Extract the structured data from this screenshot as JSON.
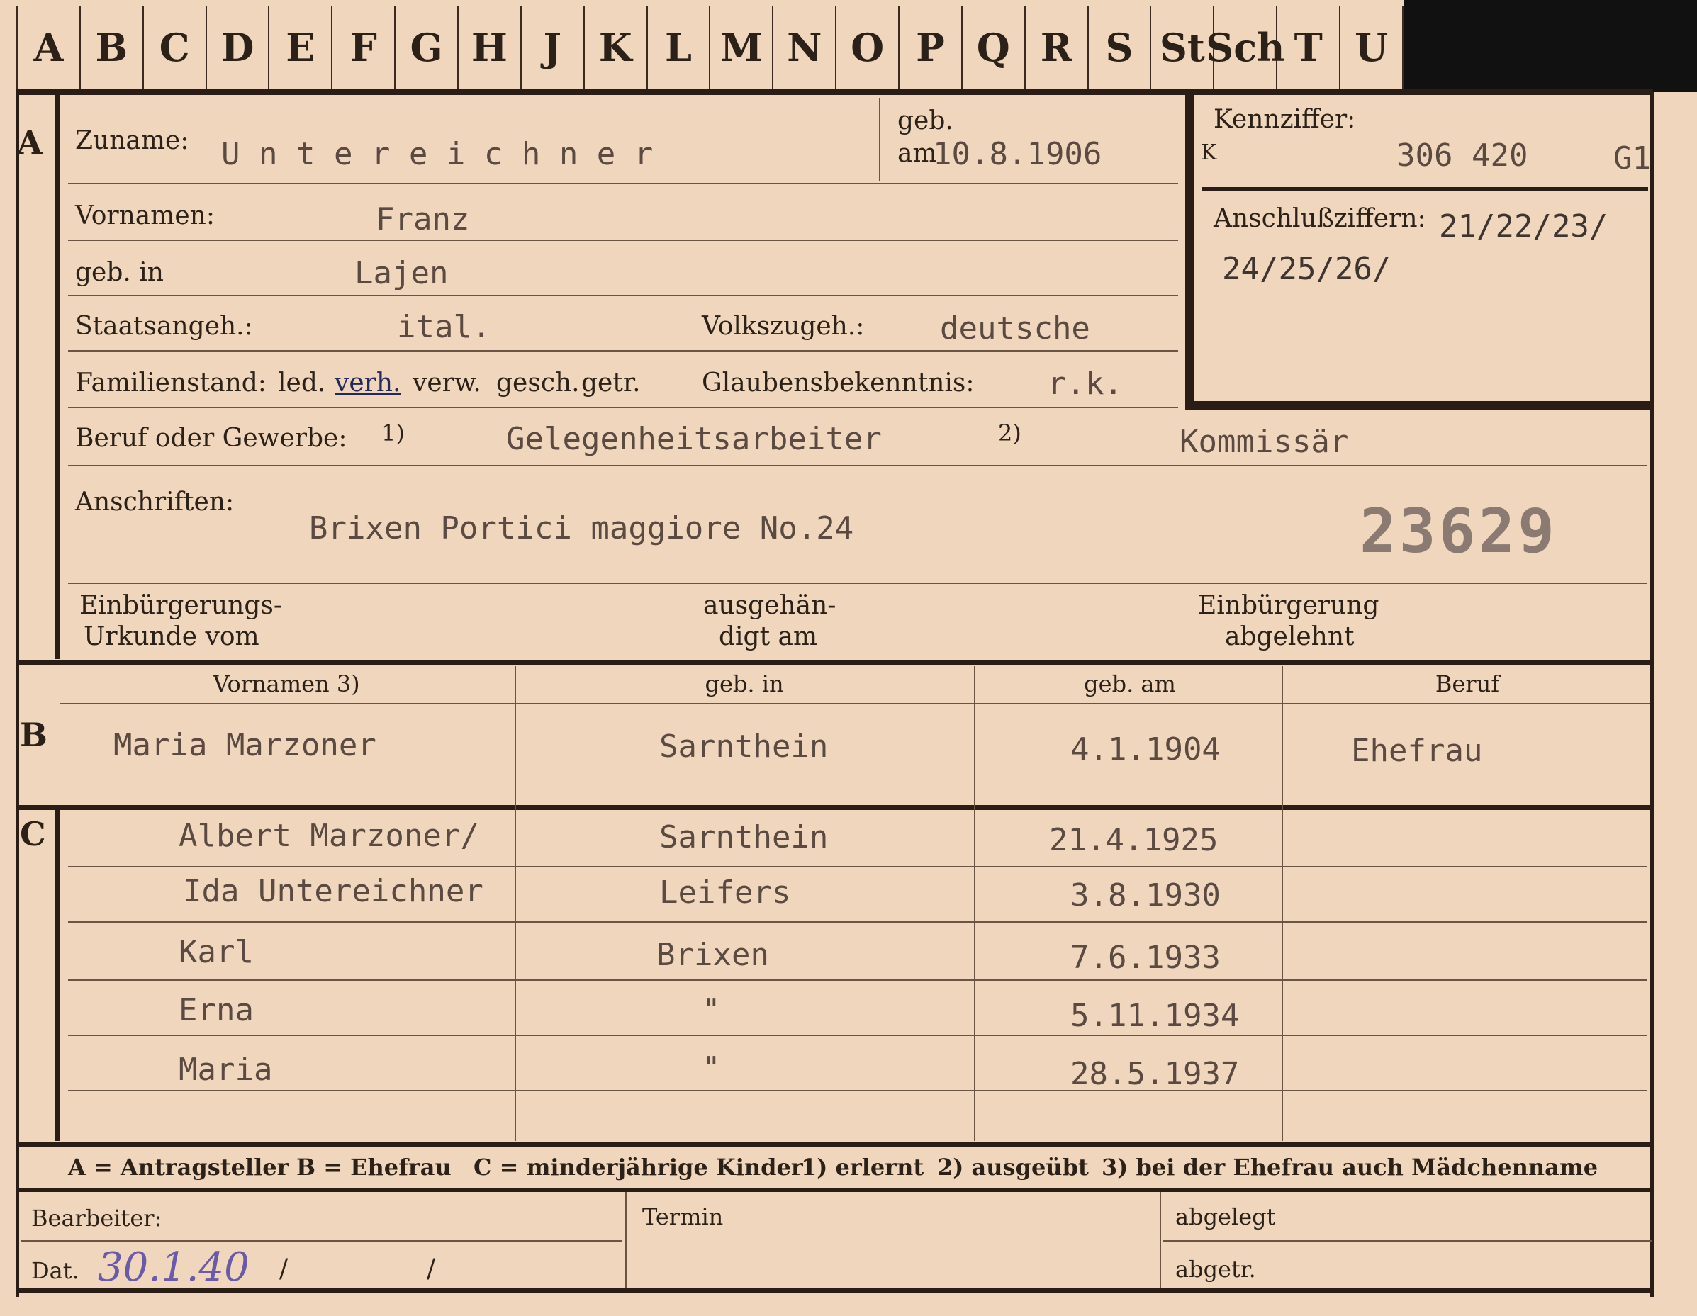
{
  "tabs": [
    "A",
    "B",
    "C",
    "D",
    "E",
    "F",
    "G",
    "H",
    "J",
    "K",
    "L",
    "M",
    "N",
    "O",
    "P",
    "Q",
    "R",
    "S",
    "St",
    "Sch",
    "T",
    "U"
  ],
  "sections": {
    "a": "A",
    "b": "B",
    "c": "C"
  },
  "header": {
    "surname_label": "Zuname:",
    "surname": "U n t e r e i c h n e r",
    "born_label_1": "geb.",
    "born_label_2": "am",
    "born_date": "10.8.1906",
    "kennziffer_label": "Kennziffer:",
    "kennziffer_prefix": "K",
    "kennziffer_value": "306 420",
    "kennziffer_suffix": "G1",
    "anschluss_label": "Anschlußziffern:",
    "anschluss_line1": "21/22/23/",
    "anschluss_line2": "24/25/26/"
  },
  "person": {
    "first_names_label": "Vornamen:",
    "first_names": "Franz",
    "birthplace_label": "geb. in",
    "birthplace": "Lajen",
    "citizenship_label": "Staatsangeh.:",
    "citizenship": "ital.",
    "ethnicity_label": "Volkszugeh.:",
    "ethnicity": "deutsche",
    "marital_label": "Familienstand:",
    "marital_options": [
      "led.",
      "verh.",
      "verw.",
      "gesch.",
      "getr."
    ],
    "religion_label": "Glaubensbekenntnis:",
    "religion": "r.k.",
    "occupation_label": "Beruf oder Gewerbe:",
    "footnote1": "1)",
    "occupation_learned": "Gelegenheitsarbeiter",
    "footnote2": "2)",
    "occupation_practiced": "Kommissär",
    "address_label": "Anschriften:",
    "address": "Brixen Portici maggiore No.24",
    "stamp_number": "23629",
    "naturalization_label_1": "Einbürgerungs-",
    "naturalization_label_2": "Urkunde vom",
    "issued_label_1": "ausgehän-",
    "issued_label_2": "digt am",
    "refused_label_1": "Einbürgerung",
    "refused_label_2": "abgelehnt"
  },
  "table_headers": [
    "Vornamen 3)",
    "geb. in",
    "geb. am",
    "Beruf"
  ],
  "spouse": {
    "name": "Maria Marzoner",
    "birthplace": "Sarnthein",
    "born": "4.1.1904",
    "occupation": "Ehefrau"
  },
  "children": [
    {
      "name": "Albert Marzoner/",
      "birthplace": "Sarnthein",
      "born": "21.4.1925"
    },
    {
      "name": "Ida Untereichner",
      "birthplace": "Leifers",
      "born": "3.8.1930"
    },
    {
      "name": "Karl",
      "birthplace": "Brixen",
      "born": "7.6.1933"
    },
    {
      "name": "Erna",
      "birthplace": "\"",
      "born": "5.11.1934"
    },
    {
      "name": "Maria",
      "birthplace": "\"",
      "born": "28.5.1937"
    }
  ],
  "legend": {
    "a": "A = Antragsteller",
    "b": "B = Ehefrau",
    "c": "C = minderjährige Kinder",
    "n1": "1) erlernt",
    "n2": "2) ausgeübt",
    "n3": "3) bei der Ehefrau auch Mädchenname"
  },
  "footer": {
    "processor_label": "Bearbeiter:",
    "date_label": "Dat.",
    "date_value": "30.1.40",
    "slash1": "/",
    "slash2": "/",
    "termin_label": "Termin",
    "filed_label": "abgelegt",
    "sent_label": "abgetr."
  }
}
